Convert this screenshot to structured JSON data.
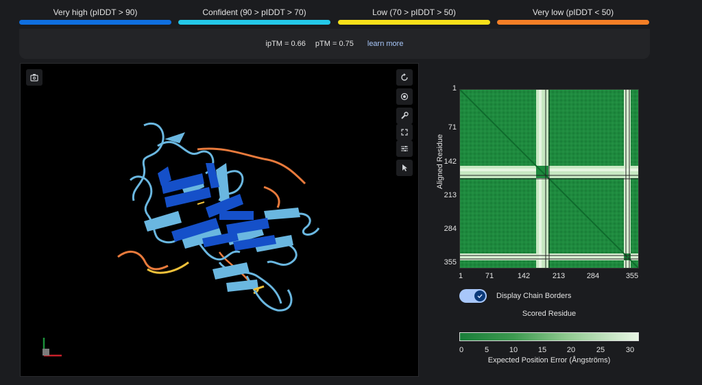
{
  "legend": [
    {
      "label": "Very high (pIDDT > 90)",
      "color": "#0f6fe0"
    },
    {
      "label": "Confident (90 > pIDDT > 70)",
      "color": "#24c8e8"
    },
    {
      "label": "Low (70 > pIDDT > 50)",
      "color": "#f7e01a"
    },
    {
      "label": "Very low (pIDDT < 50)",
      "color": "#f57f26"
    }
  ],
  "metrics": {
    "iptm": "ipTM = 0.66",
    "ptm": "pTM = 0.75",
    "learn_more": "learn more"
  },
  "viewer": {
    "buttons": [
      "screenshot-icon",
      "reset-icon",
      "center-icon",
      "wrench-icon",
      "fullscreen-icon",
      "sliders-icon",
      "pointer-icon"
    ]
  },
  "pae": {
    "y_ticks": [
      "1",
      "71",
      "142",
      "213",
      "284",
      "355"
    ],
    "x_ticks": [
      "1",
      "71",
      "142",
      "213",
      "284",
      "355"
    ],
    "y_label": "Aligned Residue",
    "toggle_label": "Display Chain Borders",
    "toggle_on": true,
    "x_label": "Scored Residue",
    "colorbar_ticks": [
      "0",
      "5",
      "10",
      "15",
      "20",
      "25",
      "30"
    ],
    "colorbar_title": "Expected Position Error (Ångströms)",
    "colors": {
      "low": "#1a7f3a",
      "high": "#e9f6e5"
    }
  }
}
